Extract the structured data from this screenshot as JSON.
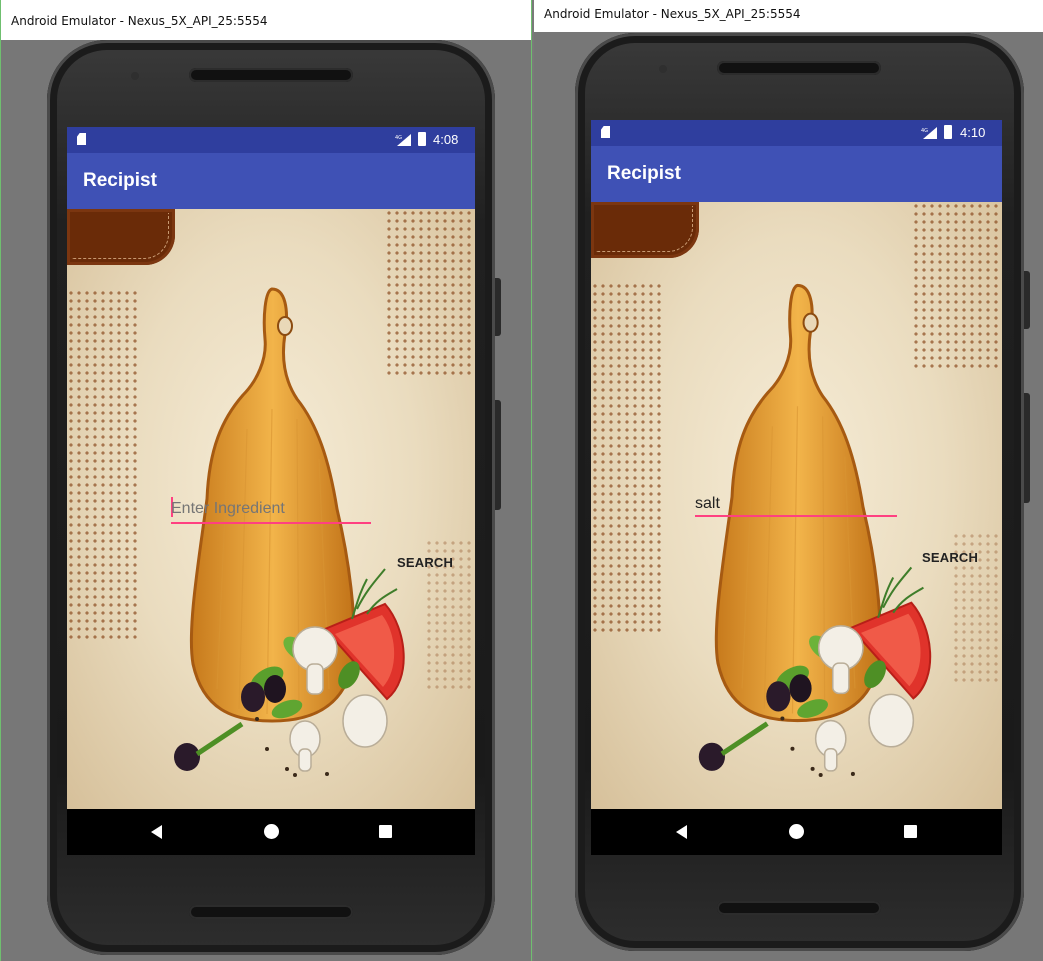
{
  "screens": [
    {
      "window_title": "Android Emulator - Nexus_5X_API_25:5554",
      "status_time": "4:08",
      "app_title": "Recipist",
      "ingredient_input": {
        "value": "",
        "placeholder": "Enter Ingredient"
      },
      "search_label": "SEARCH"
    },
    {
      "window_title": "Android Emulator - Nexus_5X_API_25:5554",
      "status_time": "4:10",
      "app_title": "Recipist",
      "ingredient_input": {
        "value": "salt",
        "placeholder": "Enter Ingredient"
      },
      "search_label": "SEARCH"
    }
  ],
  "icons": {
    "status": [
      "sd-card-icon",
      "signal-icon",
      "battery-icon"
    ],
    "navigation": [
      "back-icon",
      "home-icon",
      "recents-icon"
    ]
  },
  "colors": {
    "status_bar": "#2f3e9e",
    "app_bar": "#3f51b5",
    "input_accent": "#ff4081",
    "nav_bar": "#000000"
  }
}
